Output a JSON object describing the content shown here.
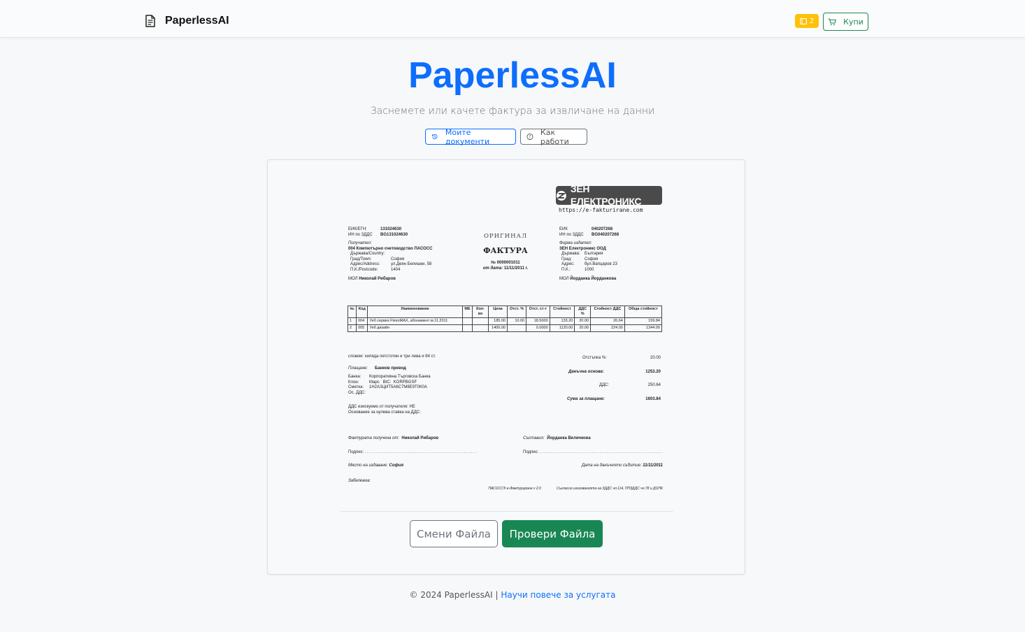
{
  "navbar": {
    "brand": "PaperlessAI",
    "credits": "2",
    "buy_label": "Купи"
  },
  "hero": {
    "title": "PaperlessAI",
    "subtitle": "Заснемете или качете фактура за извличане на данни",
    "my_docs_label": "Моите документи",
    "how_label": "Как работи"
  },
  "invoice": {
    "logo_text": "ЗЕН ЕЛЕКТРОНИКС",
    "logo_url": "https://e-fakturirane.com",
    "original": "ОРИГИНАЛ",
    "doc_type": "ФАКТУРА",
    "number": "№ 0000001011",
    "date_label": "от дата:",
    "date": "11/11/2011 г.",
    "buyer": {
      "eik_label": "ЕИК/ЕГН:",
      "eik": "131024630",
      "vat_label": "ИН по ЗДДС",
      "vat": "BG131024630",
      "role": "Получател:",
      "name": "004  Компютърно счетоводство ПАСОСС",
      "country_label": "Държава/Country:",
      "country": "",
      "city_label": "Град/Town:",
      "city": "София",
      "address_label": "Адрес/Address:",
      "address": "ул.Деян Белишки, 58",
      "postcode_label": "П.К./Postcode:",
      "postcode": "1404",
      "mol_label": "МОЛ",
      "mol": "Николай Рибаров"
    },
    "seller": {
      "eik_label": "ЕИК",
      "eik": "040207268",
      "vat_label": "ИН по ЗДДС",
      "vat": "BG040207268",
      "role": "Фирма издател:",
      "name": "ЗЕН Електроникс ООД",
      "country_label": "Държава:",
      "country": "България",
      "city_label": "Град:",
      "city": "София",
      "address_label": "Адрес:",
      "address": "бул.Вапцаров 23",
      "postcode_label": "П.К.:",
      "postcode": "1000",
      "mol_label": "МОЛ",
      "mol": "Йорданка Йорданкова"
    },
    "table": {
      "headers": [
        "№",
        "Код",
        "Наименование",
        "МЕ",
        "Кол-во",
        "Цена",
        "Отст. %",
        "Отст. ст-т",
        "Стойност",
        "ДДС %",
        "Стойност ДДС",
        "Обща стойност"
      ],
      "rows": [
        [
          "1",
          "004",
          "Уеб сервиз FlexoMAX, абонамент м.11.2011",
          "",
          "",
          "185.00",
          "10.00",
          "18.5000",
          "133.20",
          "20.00",
          "26.64",
          "159.84"
        ],
        [
          "2",
          "005",
          "Уеб дизайн",
          "",
          "",
          "1400.00",
          "",
          "0.0000",
          "1120.00",
          "20.00",
          "224.00",
          "1344.00"
        ]
      ]
    },
    "words_label": "словом:",
    "words": "хиляда петстотин и три лева и 84 ст.",
    "payment_label": "Плащане:",
    "payment": "Банков превод",
    "bank_label": "Банка:",
    "bank": "Корпоративна Търговска Банка",
    "branch_label": "Клон:",
    "branch": "Марс",
    "bic_label": "BIC:",
    "bic": "KORPBGSF",
    "account_label": "Сметка:",
    "account": "1Н2АЗЦИТ5А6С7М8Е9Т0К0А",
    "vat_free_label": "Ос. ДДС:",
    "discount_label": "Отстъпка %:",
    "discount": "20.00",
    "tax_base_label": "Данъчна основа:",
    "tax_base": "1253.20",
    "vat_amount_label": "ДДС:",
    "vat_amount": "250.64",
    "total_label": "Сума за плащане:",
    "total": "1603.84",
    "note1": "ДДС изискуемо от получателя: НЕ",
    "note2": "Основание за нулева ставка на ДДС:",
    "received_label": "Фактурата получена от:",
    "received_by": "Николай Рибаров",
    "issued_label": "Съставил:",
    "issued_by": "Йорданка Величкова",
    "sign_label": "Подпис:",
    "place_label": "Място на издаване:",
    "place": "София",
    "tax_date_label": "Дата на данъчното събитие:",
    "tax_date": "11/11/2011",
    "remarks_label": "Забележка:",
    "footer_left": "ПАСОСС® е-Фактуриране  v 2.0",
    "footer_right": "Съгласно изискванията на ЗДДС чл.114, ППЗДДС чл.78 и ДОПК"
  },
  "actions": {
    "change_label": "Смени Файла",
    "check_label": "Провери Файла"
  },
  "footer": {
    "copyright": "© 2024 PaperlessAI |",
    "link": "Научи повече за услугата"
  },
  "colors": {
    "primary": "#0d6efd",
    "success": "#198754",
    "warning": "#ffc107"
  }
}
